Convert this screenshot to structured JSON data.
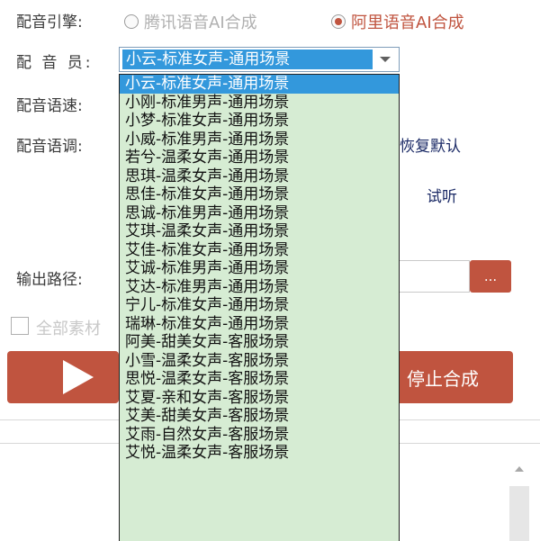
{
  "engine": {
    "label": "配音引擎:",
    "options": [
      {
        "label": "腾讯语音AI合成",
        "checked": false
      },
      {
        "label": "阿里语音AI合成",
        "checked": true
      }
    ]
  },
  "voice": {
    "label": "配 音 员:",
    "selected": "小云-标准女声-通用场景",
    "options": [
      "小云-标准女声-通用场景",
      "小刚-标准男声-通用场景",
      "小梦-标准女声-通用场景",
      "小威-标准男声-通用场景",
      "若兮-温柔女声-通用场景",
      "思琪-温柔女声-通用场景",
      "思佳-标准女声-通用场景",
      "思诚-标准男声-通用场景",
      "艾琪-温柔女声-通用场景",
      "艾佳-标准女声-通用场景",
      "艾诚-标准男声-通用场景",
      "艾达-标准男声-通用场景",
      "宁儿-标准女声-通用场景",
      "瑞琳-标准女声-通用场景",
      "阿美-甜美女声-客服场景",
      "小雪-温柔女声-客服场景",
      "思悦-温柔女声-客服场景",
      "艾夏-亲和女声-客服场景",
      "艾美-甜美女声-客服场景",
      "艾雨-自然女声-客服场景",
      "艾悦-温柔女声-客服场景"
    ]
  },
  "speed": {
    "label": "配音语速:"
  },
  "pitch": {
    "label": "配音语调:"
  },
  "restore_default": "恢复默认",
  "preview": "试听",
  "output": {
    "label": "输出路径:",
    "browse_label": "..."
  },
  "all_material": {
    "label": "全部素材"
  },
  "stop_button": "停止合成",
  "colors": {
    "accent": "#c0543f",
    "selection": "#3398dc",
    "list_bg": "#d6ecd3"
  }
}
